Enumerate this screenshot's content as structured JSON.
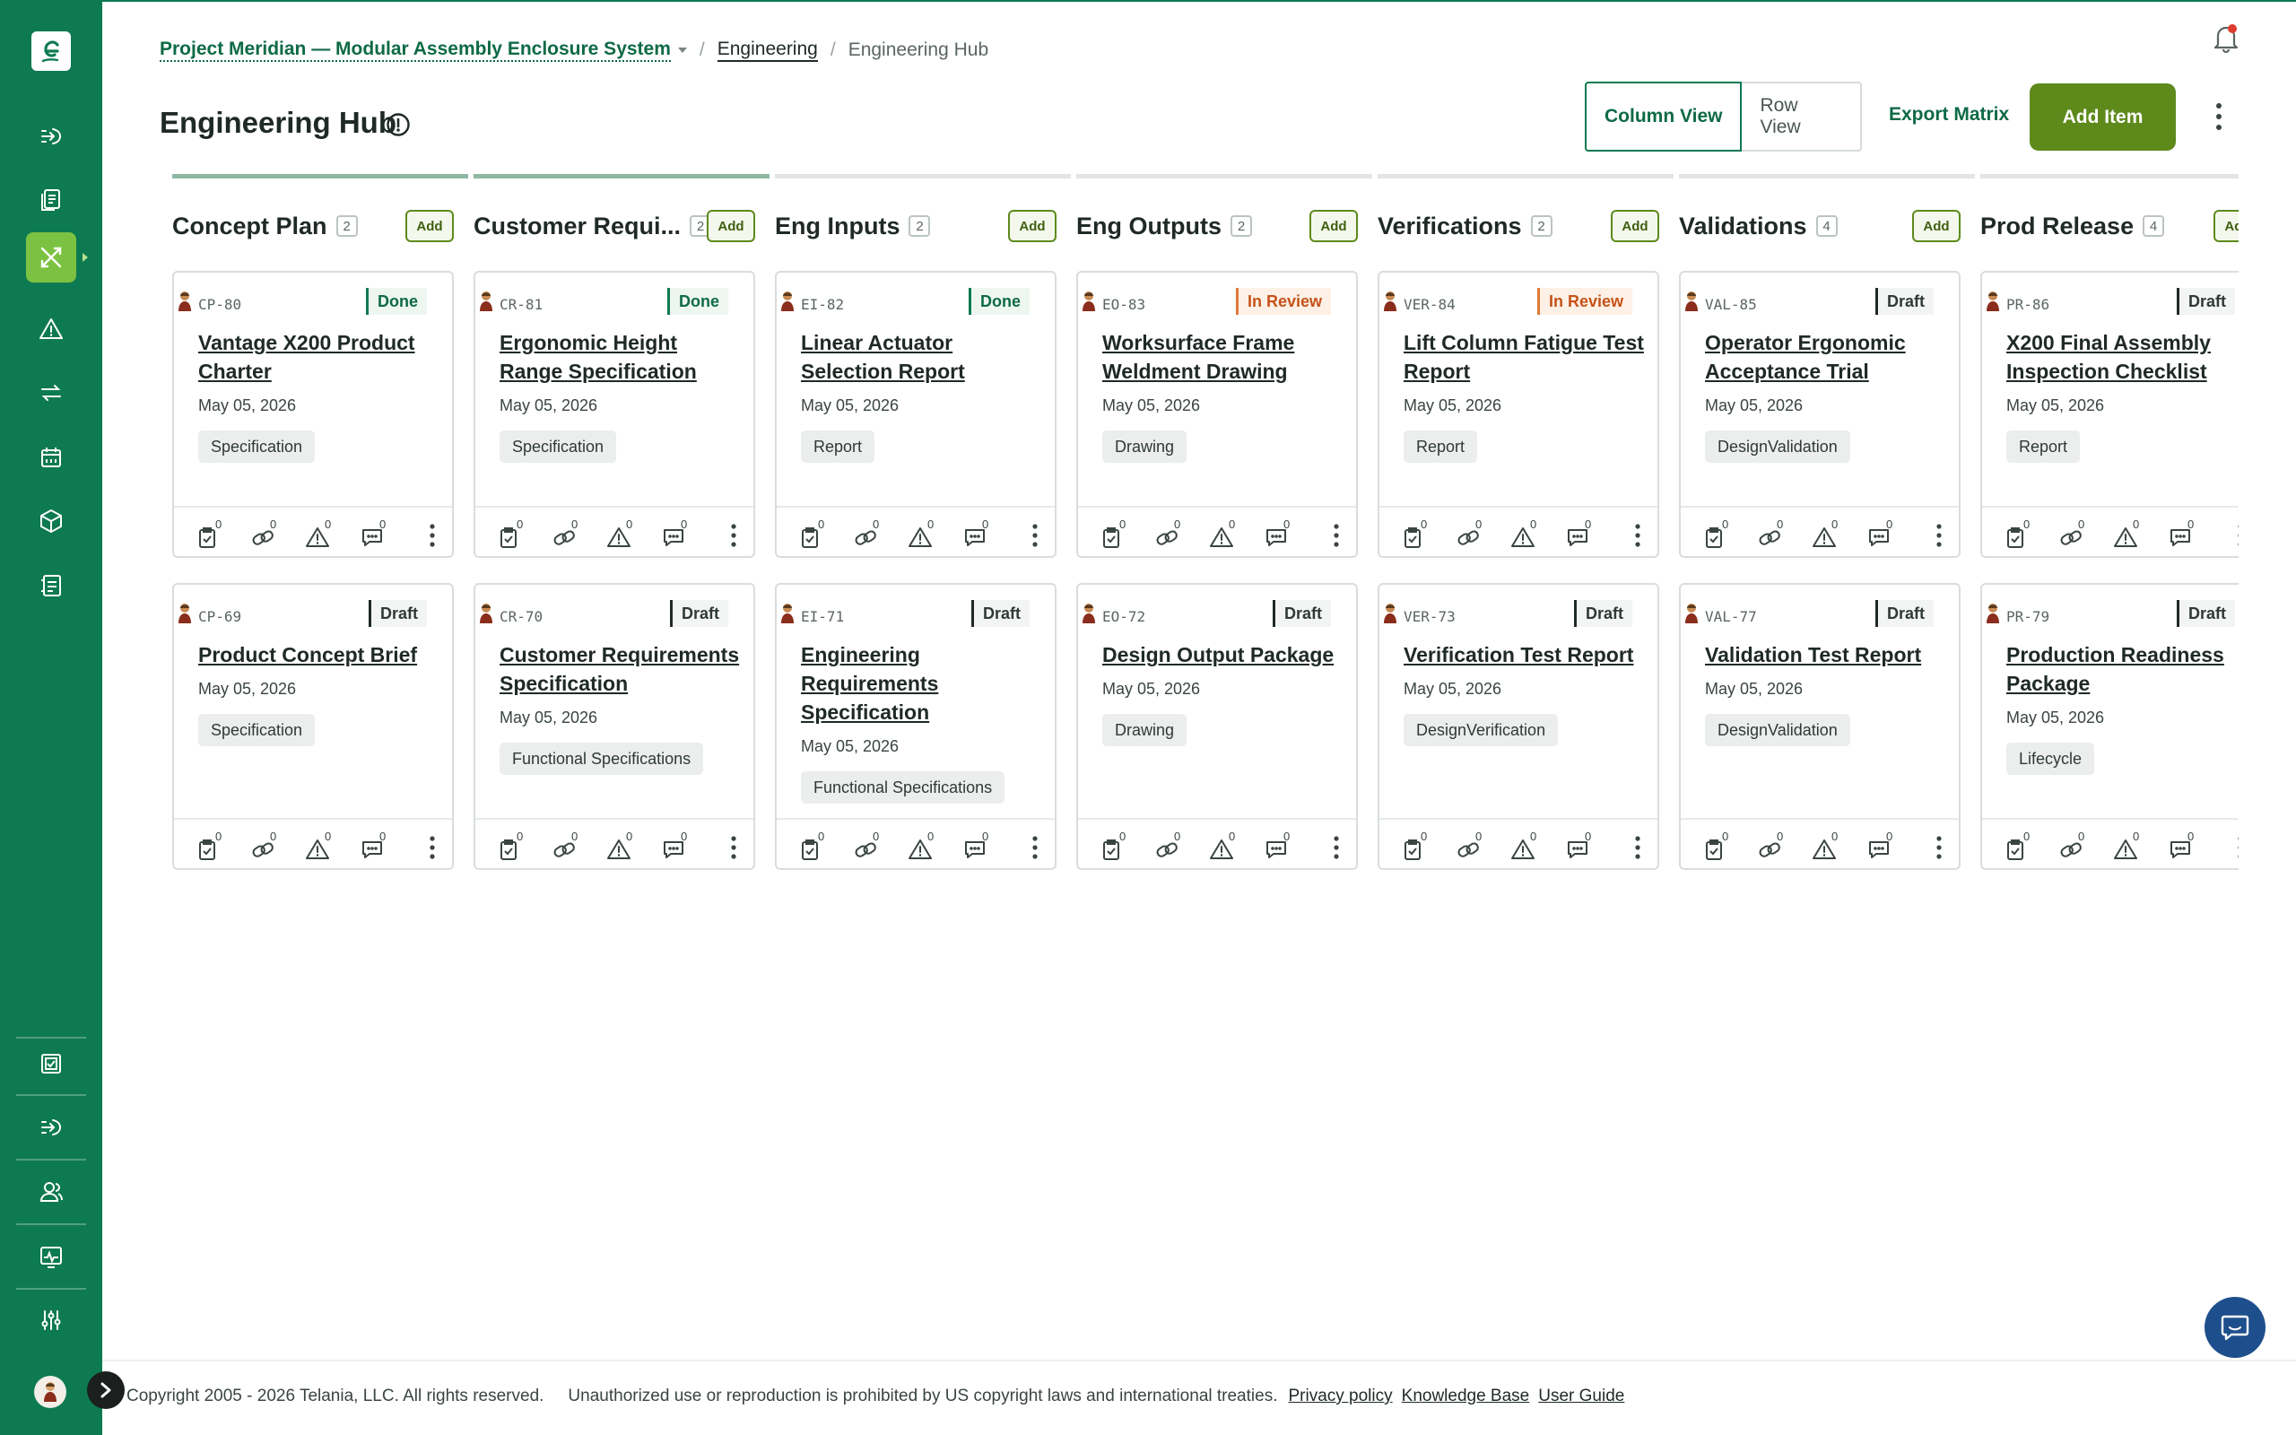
{
  "header": {
    "project": "Project Meridian — Modular Assembly Enclosure System",
    "breadcrumb_engineering": "Engineering",
    "breadcrumb_current": "Engineering Hub",
    "title": "Engineering Hub"
  },
  "toolbar": {
    "column_view": "Column View",
    "row_view": "Row View",
    "export": "Export Matrix",
    "add_item": "Add Item"
  },
  "columns": [
    {
      "title": "Concept Plan",
      "count": "2",
      "add": "Add",
      "progress": 1.0,
      "cards": [
        {
          "id": "CP-80",
          "status": "Done",
          "title": "Vantage X200 Product Charter",
          "date": "May 05, 2026",
          "tag": "Specification"
        },
        {
          "id": "CP-69",
          "status": "Draft",
          "title": "Product Concept Brief",
          "date": "May 05, 2026",
          "tag": "Specification"
        }
      ]
    },
    {
      "title": "Customer Requi...",
      "count": "2",
      "add": "Add",
      "progress": 1.0,
      "cards": [
        {
          "id": "CR-81",
          "status": "Done",
          "title": "Ergonomic Height Range Specification",
          "date": "May 05, 2026",
          "tag": "Specification"
        },
        {
          "id": "CR-70",
          "status": "Draft",
          "title": "Customer Requirements Specification",
          "date": "May 05, 2026",
          "tag": "Functional Specifications"
        }
      ]
    },
    {
      "title": "Eng Inputs",
      "count": "2",
      "add": "Add",
      "progress": 0.0,
      "cards": [
        {
          "id": "EI-82",
          "status": "Done",
          "title": "Linear Actuator Selection Report",
          "date": "May 05, 2026",
          "tag": "Report"
        },
        {
          "id": "EI-71",
          "status": "Draft",
          "title": "Engineering Requirements Specification",
          "date": "May 05, 2026",
          "tag": "Functional Specifications"
        }
      ]
    },
    {
      "title": "Eng Outputs",
      "count": "2",
      "add": "Add",
      "progress": 0.0,
      "cards": [
        {
          "id": "EO-83",
          "status": "In Review",
          "title": "Worksurface Frame Weldment Drawing",
          "date": "May 05, 2026",
          "tag": "Drawing"
        },
        {
          "id": "EO-72",
          "status": "Draft",
          "title": "Design Output Package",
          "date": "May 05, 2026",
          "tag": "Drawing"
        }
      ]
    },
    {
      "title": "Verifications",
      "count": "2",
      "add": "Add",
      "progress": 0.0,
      "cards": [
        {
          "id": "VER-84",
          "status": "In Review",
          "title": "Lift Column Fatigue Test Report",
          "date": "May 05, 2026",
          "tag": "Report"
        },
        {
          "id": "VER-73",
          "status": "Draft",
          "title": "Verification Test Report",
          "date": "May 05, 2026",
          "tag": "DesignVerification"
        }
      ]
    },
    {
      "title": "Validations",
      "count": "4",
      "add": "Add",
      "progress": 0.0,
      "cards": [
        {
          "id": "VAL-85",
          "status": "Draft",
          "title": "Operator Ergonomic Acceptance Trial",
          "date": "May 05, 2026",
          "tag": "DesignValidation"
        },
        {
          "id": "VAL-77",
          "status": "Draft",
          "title": "Validation Test Report",
          "date": "May 05, 2026",
          "tag": "DesignValidation"
        }
      ]
    },
    {
      "title": "Prod Release",
      "count": "4",
      "add": "Add",
      "progress": 0.0,
      "cards": [
        {
          "id": "PR-86",
          "status": "Draft",
          "title": "X200 Final Assembly Inspection Checklist",
          "date": "May 05, 2026",
          "tag": "Report"
        },
        {
          "id": "PR-79",
          "status": "Draft",
          "title": "Production Readiness Package",
          "date": "May 05, 2026",
          "tag": "Lifecycle"
        }
      ]
    }
  ],
  "card_action_counts": {
    "tasks": "0",
    "links": "0",
    "risks": "0",
    "comments": "0"
  },
  "footer": {
    "copyright": "Copyright 2005 - 2026 Telania, LLC. All rights reserved.",
    "notice": "Unauthorized use or reproduction is prohibited by US copyright laws and international treaties.",
    "privacy": "Privacy policy",
    "kb": "Knowledge Base",
    "guide": "User Guide"
  },
  "icons": {
    "sidebar": [
      "logo-icon",
      "dashboard-icon",
      "documents-icon",
      "engineering-icon",
      "risk-icon",
      "change-icon",
      "calendar-icon",
      "product-icon",
      "forms-icon",
      "tasks-icon",
      "training-icon",
      "people-icon",
      "analytics-icon",
      "settings-icon"
    ],
    "card_actions": [
      "task-icon",
      "link-icon",
      "risk-icon",
      "comment-icon",
      "more-icon"
    ]
  },
  "colors": {
    "brand": "#0e7a52",
    "accent": "#7cc242",
    "add_button": "#5e8a1c",
    "status_done": "#0e7a52",
    "status_review": "#e07a3a",
    "status_draft": "#1f2a24"
  }
}
